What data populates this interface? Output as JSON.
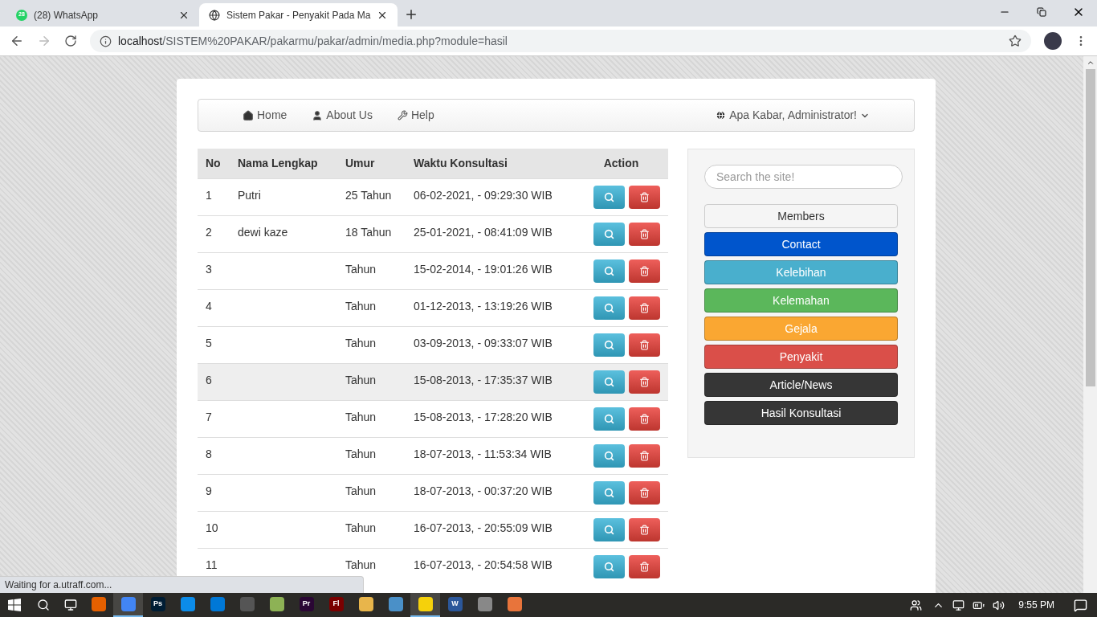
{
  "browser": {
    "tabs": [
      {
        "title": "(28) WhatsApp",
        "badge": "28",
        "kind": "chat",
        "selected": false
      },
      {
        "title": "Sistem Pakar - Penyakit Pada Ma",
        "kind": "globe",
        "selected": true
      }
    ],
    "address": {
      "host": "localhost",
      "path": "/SISTEM%20PAKAR/pakarmu/pakar/admin/media.php?module=hasil"
    }
  },
  "navbar": {
    "items": [
      {
        "label": "Home",
        "kind": "home"
      },
      {
        "label": "About Us",
        "kind": "user"
      },
      {
        "label": "Help",
        "kind": "wrench"
      }
    ],
    "user_menu": "Apa Kabar, Administrator!"
  },
  "table": {
    "columns": [
      "No",
      "Nama Lengkap",
      "Umur",
      "Waktu Konsultasi",
      "Action"
    ],
    "rows": [
      {
        "no": "1",
        "name": "Putri",
        "age": "25 Tahun",
        "time": "06-02-2021, - 09:29:30 WIB",
        "highlighted": false
      },
      {
        "no": "2",
        "name": "dewi kaze",
        "age": "18 Tahun",
        "time": "25-01-2021, - 08:41:09 WIB",
        "highlighted": false
      },
      {
        "no": "3",
        "age": "Tahun",
        "time": "15-02-2014, - 19:01:26 WIB",
        "highlighted": false
      },
      {
        "no": "4",
        "age": "Tahun",
        "time": "01-12-2013, - 13:19:26 WIB",
        "highlighted": false
      },
      {
        "no": "5",
        "age": "Tahun",
        "time": "03-09-2013, - 09:33:07 WIB",
        "highlighted": false
      },
      {
        "no": "6",
        "age": "Tahun",
        "time": "15-08-2013, - 17:35:37 WIB",
        "highlighted": true
      },
      {
        "no": "7",
        "age": "Tahun",
        "time": "15-08-2013, - 17:28:20 WIB",
        "highlighted": false
      },
      {
        "no": "8",
        "age": "Tahun",
        "time": "18-07-2013, - 11:53:34 WIB",
        "highlighted": false
      },
      {
        "no": "9",
        "age": "Tahun",
        "time": "18-07-2013, - 00:37:20 WIB",
        "highlighted": false
      },
      {
        "no": "10",
        "age": "Tahun",
        "time": "16-07-2013, - 20:55:09 WIB",
        "highlighted": false
      },
      {
        "no": "11",
        "age": "Tahun",
        "time": "16-07-2013, - 20:54:58 WIB",
        "highlighted": false
      }
    ]
  },
  "sidebar": {
    "search": {
      "placeholder": "Search the site!"
    },
    "menu": [
      {
        "label": "Members",
        "color": "#f5f5f5"
      },
      {
        "label": "Contact",
        "color": "#0055cc"
      },
      {
        "label": "Kelebihan",
        "color": "#49afcd"
      },
      {
        "label": "Kelemahan",
        "color": "#5bb75b"
      },
      {
        "label": "Gejala",
        "color": "#faa732"
      },
      {
        "label": "Penyakit",
        "color": "#da4f49"
      },
      {
        "label": "Article/News",
        "color": "#363636"
      },
      {
        "label": "Hasil Konsultasi",
        "color": "#363636"
      }
    ]
  },
  "status_bar": "Waiting for a.utraff.com...",
  "taskbar": {
    "apps": [
      {
        "color": "#e66000",
        "selected": false
      },
      {
        "color": "#4285f4",
        "selected": true
      },
      {
        "label": "Ps",
        "color": "#001d34",
        "selected": false
      },
      {
        "color": "#0c8ce9",
        "selected": false
      },
      {
        "color": "#0078d7",
        "selected": false
      },
      {
        "color": "#555555",
        "selected": false
      },
      {
        "color": "#8db255",
        "selected": false
      },
      {
        "label": "Pr",
        "color": "#2a0634",
        "selected": false
      },
      {
        "label": "Fl",
        "color": "#7a0000",
        "selected": false
      },
      {
        "color": "#e8b54b",
        "selected": false
      },
      {
        "color": "#4a90c8",
        "selected": false
      },
      {
        "color": "#f5d10b",
        "selected": true
      },
      {
        "label": "W",
        "color": "#2b579a",
        "selected": false
      },
      {
        "color": "#888888",
        "selected": false
      },
      {
        "color": "#e8743b",
        "selected": false
      }
    ],
    "clock": "9:55 PM"
  }
}
